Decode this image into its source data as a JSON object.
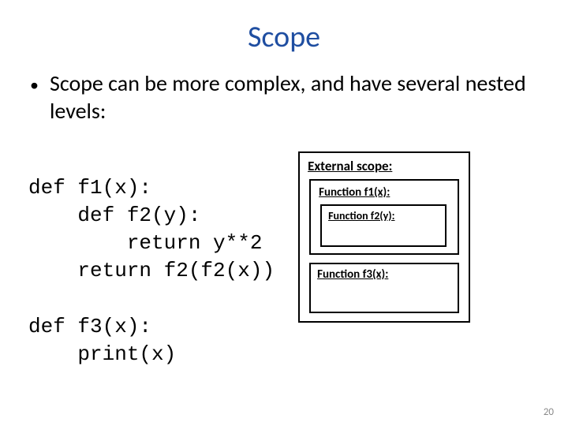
{
  "title": "Scope",
  "bullet": "Scope can be more complex, and have several nested levels:",
  "code": {
    "line1": "def f1(x):",
    "line2": "    def f2(y):",
    "line3": "        return y**2",
    "line4": "    return f2(f2(x))",
    "blank": "",
    "line5": "def f3(x):",
    "line6": "    print(x)"
  },
  "diagram": {
    "outer": "External scope:",
    "f1": "Function f1(x):",
    "f2": "Function f2(y):",
    "f3": "Function f3(x):"
  },
  "page_number": "20"
}
